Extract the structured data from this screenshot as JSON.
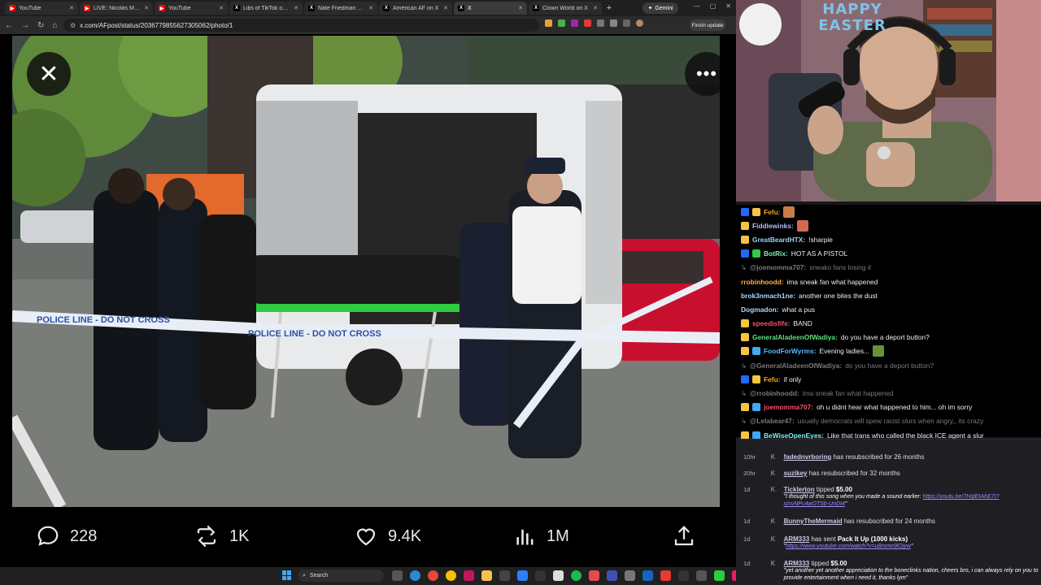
{
  "browser": {
    "tabs": [
      {
        "label": "YouTube",
        "color": "#ff0000",
        "glyph": "▶",
        "active": false
      },
      {
        "label": "LIVE: Nicolás Maduro",
        "color": "#ff0000",
        "glyph": "▶",
        "active": false
      },
      {
        "label": "YouTube",
        "color": "#ff0000",
        "glyph": "▶",
        "active": false
      },
      {
        "label": "Libs of TikTok on X",
        "color": "#000000",
        "glyph": "X",
        "active": false
      },
      {
        "label": "Nate Friedman on X",
        "color": "#000000",
        "glyph": "X",
        "active": false
      },
      {
        "label": "American AF on X",
        "color": "#000000",
        "glyph": "X",
        "active": false
      },
      {
        "label": "X",
        "color": "#000000",
        "glyph": "X",
        "active": true
      },
      {
        "label": "Clown World on X",
        "color": "#000000",
        "glyph": "X",
        "active": false
      }
    ],
    "gemini_label": "Gemini",
    "url": "x.com/AFpost/status/2036779855627305062/photo/1",
    "finish_update_label": "Finish update"
  },
  "post": {
    "replies": "228",
    "reposts": "1K",
    "likes": "9.4K",
    "views": "1M",
    "tape_text": "POLICE LINE  -  DO NOT CROSS"
  },
  "taskbar": {
    "search_label": "Search"
  },
  "stream": {
    "overlay_text": "HAPPY EASTER",
    "chat": [
      {
        "user": "Fefu:",
        "text": "",
        "color": "#f5a623",
        "badges": [
          "#1f69ff",
          "#f5c542"
        ],
        "reply": false,
        "emote": "#c77c4a"
      },
      {
        "user": "Fiddlewinks:",
        "text": "",
        "color": "#b9b9ff",
        "badges": [
          "#f5c542"
        ],
        "reply": false,
        "emote": "#d06a4f"
      },
      {
        "user": "GreatBeardHTX:",
        "text": "!sharpie",
        "color": "#9ad0ff",
        "badges": [
          "#f5c542"
        ],
        "reply": false,
        "emote": ""
      },
      {
        "user": "BotRix:",
        "text": "HOT AS A PISTOL",
        "color": "#7ef0b0",
        "badges": [
          "#1f69ff",
          "#2ecc40"
        ],
        "reply": false,
        "emote": ""
      },
      {
        "user": "@joemomma707:",
        "text": "sneako fans losing it",
        "color": "#7a7a80",
        "badges": [],
        "reply": true,
        "emote": ""
      },
      {
        "user": "rrobinhoodd:",
        "text": "ima sneak fan what happened",
        "color": "#ffb347",
        "badges": [],
        "reply": false,
        "emote": ""
      },
      {
        "user": "brok3nmach1ne:",
        "text": "another one bites the dust",
        "color": "#a8d8ff",
        "badges": [],
        "reply": false,
        "emote": ""
      },
      {
        "user": "Dogmadon:",
        "text": "what a pus",
        "color": "#a8d8ff",
        "badges": [],
        "reply": false,
        "emote": ""
      },
      {
        "user": "speedisfife:",
        "text": "BAND",
        "color": "#ff4d6d",
        "badges": [
          "#f5c542"
        ],
        "reply": false,
        "emote": ""
      },
      {
        "user": "GeneralAladeenOfWadiya:",
        "text": "do you have a deport button?",
        "color": "#5ce07a",
        "badges": [
          "#f5c542"
        ],
        "reply": false,
        "emote": ""
      },
      {
        "user": "FoodForWyrms:",
        "text": "Evening ladies...",
        "color": "#56b8ff",
        "badges": [
          "#f5c542",
          "#3fa9f5"
        ],
        "reply": false,
        "emote": "#6a8f3a"
      },
      {
        "user": "@GeneralAladeenOfWadiya:",
        "text": "do you have a deport button?",
        "color": "#7a7a80",
        "badges": [],
        "reply": true,
        "emote": ""
      },
      {
        "user": "Fefu:",
        "text": "if only",
        "color": "#f5a623",
        "badges": [
          "#1f69ff",
          "#f5c542"
        ],
        "reply": false,
        "emote": ""
      },
      {
        "user": "@rrobinhoodd:",
        "text": "ima sneak fan what happened",
        "color": "#7a7a80",
        "badges": [],
        "reply": true,
        "emote": ""
      },
      {
        "user": "joemomma707:",
        "text": "oh u didnt hear what happened to him... oh im sorry",
        "color": "#ff4d6d",
        "badges": [
          "#f5c542",
          "#3fa9f5"
        ],
        "reply": false,
        "emote": ""
      },
      {
        "user": "@Lelabear47:",
        "text": "usually democrats will spew racist slurs when angry,, its crazy",
        "color": "#7a7a80",
        "badges": [],
        "reply": true,
        "emote": ""
      },
      {
        "user": "BeWiseOpenEyes:",
        "text": "Like that trans who called the black ICE agent a slur",
        "color": "#7ef0f0",
        "badges": [
          "#f5c542",
          "#3fa9f5"
        ],
        "reply": false,
        "emote": ""
      }
    ],
    "events": [
      {
        "time": "10hr",
        "user": "fadednvrboring",
        "text": "has resubscribed for 26 months"
      },
      {
        "time": "20hr",
        "user": "suzikey",
        "text": "has resubscribed for 32 months"
      },
      {
        "time": "1d",
        "user": "Ticklerton",
        "text": "tipped",
        "amount": "$5.00",
        "quote": "\"I thought of this song when you made a sound earlier: ",
        "link": "https://youtu.be/7HqlEtAhE7I?si=vNPc4wOTSb-UnDI4",
        "quote_end": "\""
      },
      {
        "time": "1d",
        "user": "BunnyTheMermaid",
        "text": "has resubscribed for 24 months"
      },
      {
        "time": "1d",
        "user": "ARM333",
        "text": "has sent",
        "amount": "Pack It Up (1000 kicks)",
        "link": "https://www.youtube.com/watch?v=u8mmn9lOjyw",
        "quote": "\"",
        "quote_end": "\""
      },
      {
        "time": "1d",
        "user": "ARM333",
        "text": "tipped",
        "amount": "$5.00",
        "quote": "\"yet another yet another appreciation to the boneclinks nation, cheers bro, i can always rely on you to provide entertainment when i need it, thanks lym\""
      }
    ]
  }
}
